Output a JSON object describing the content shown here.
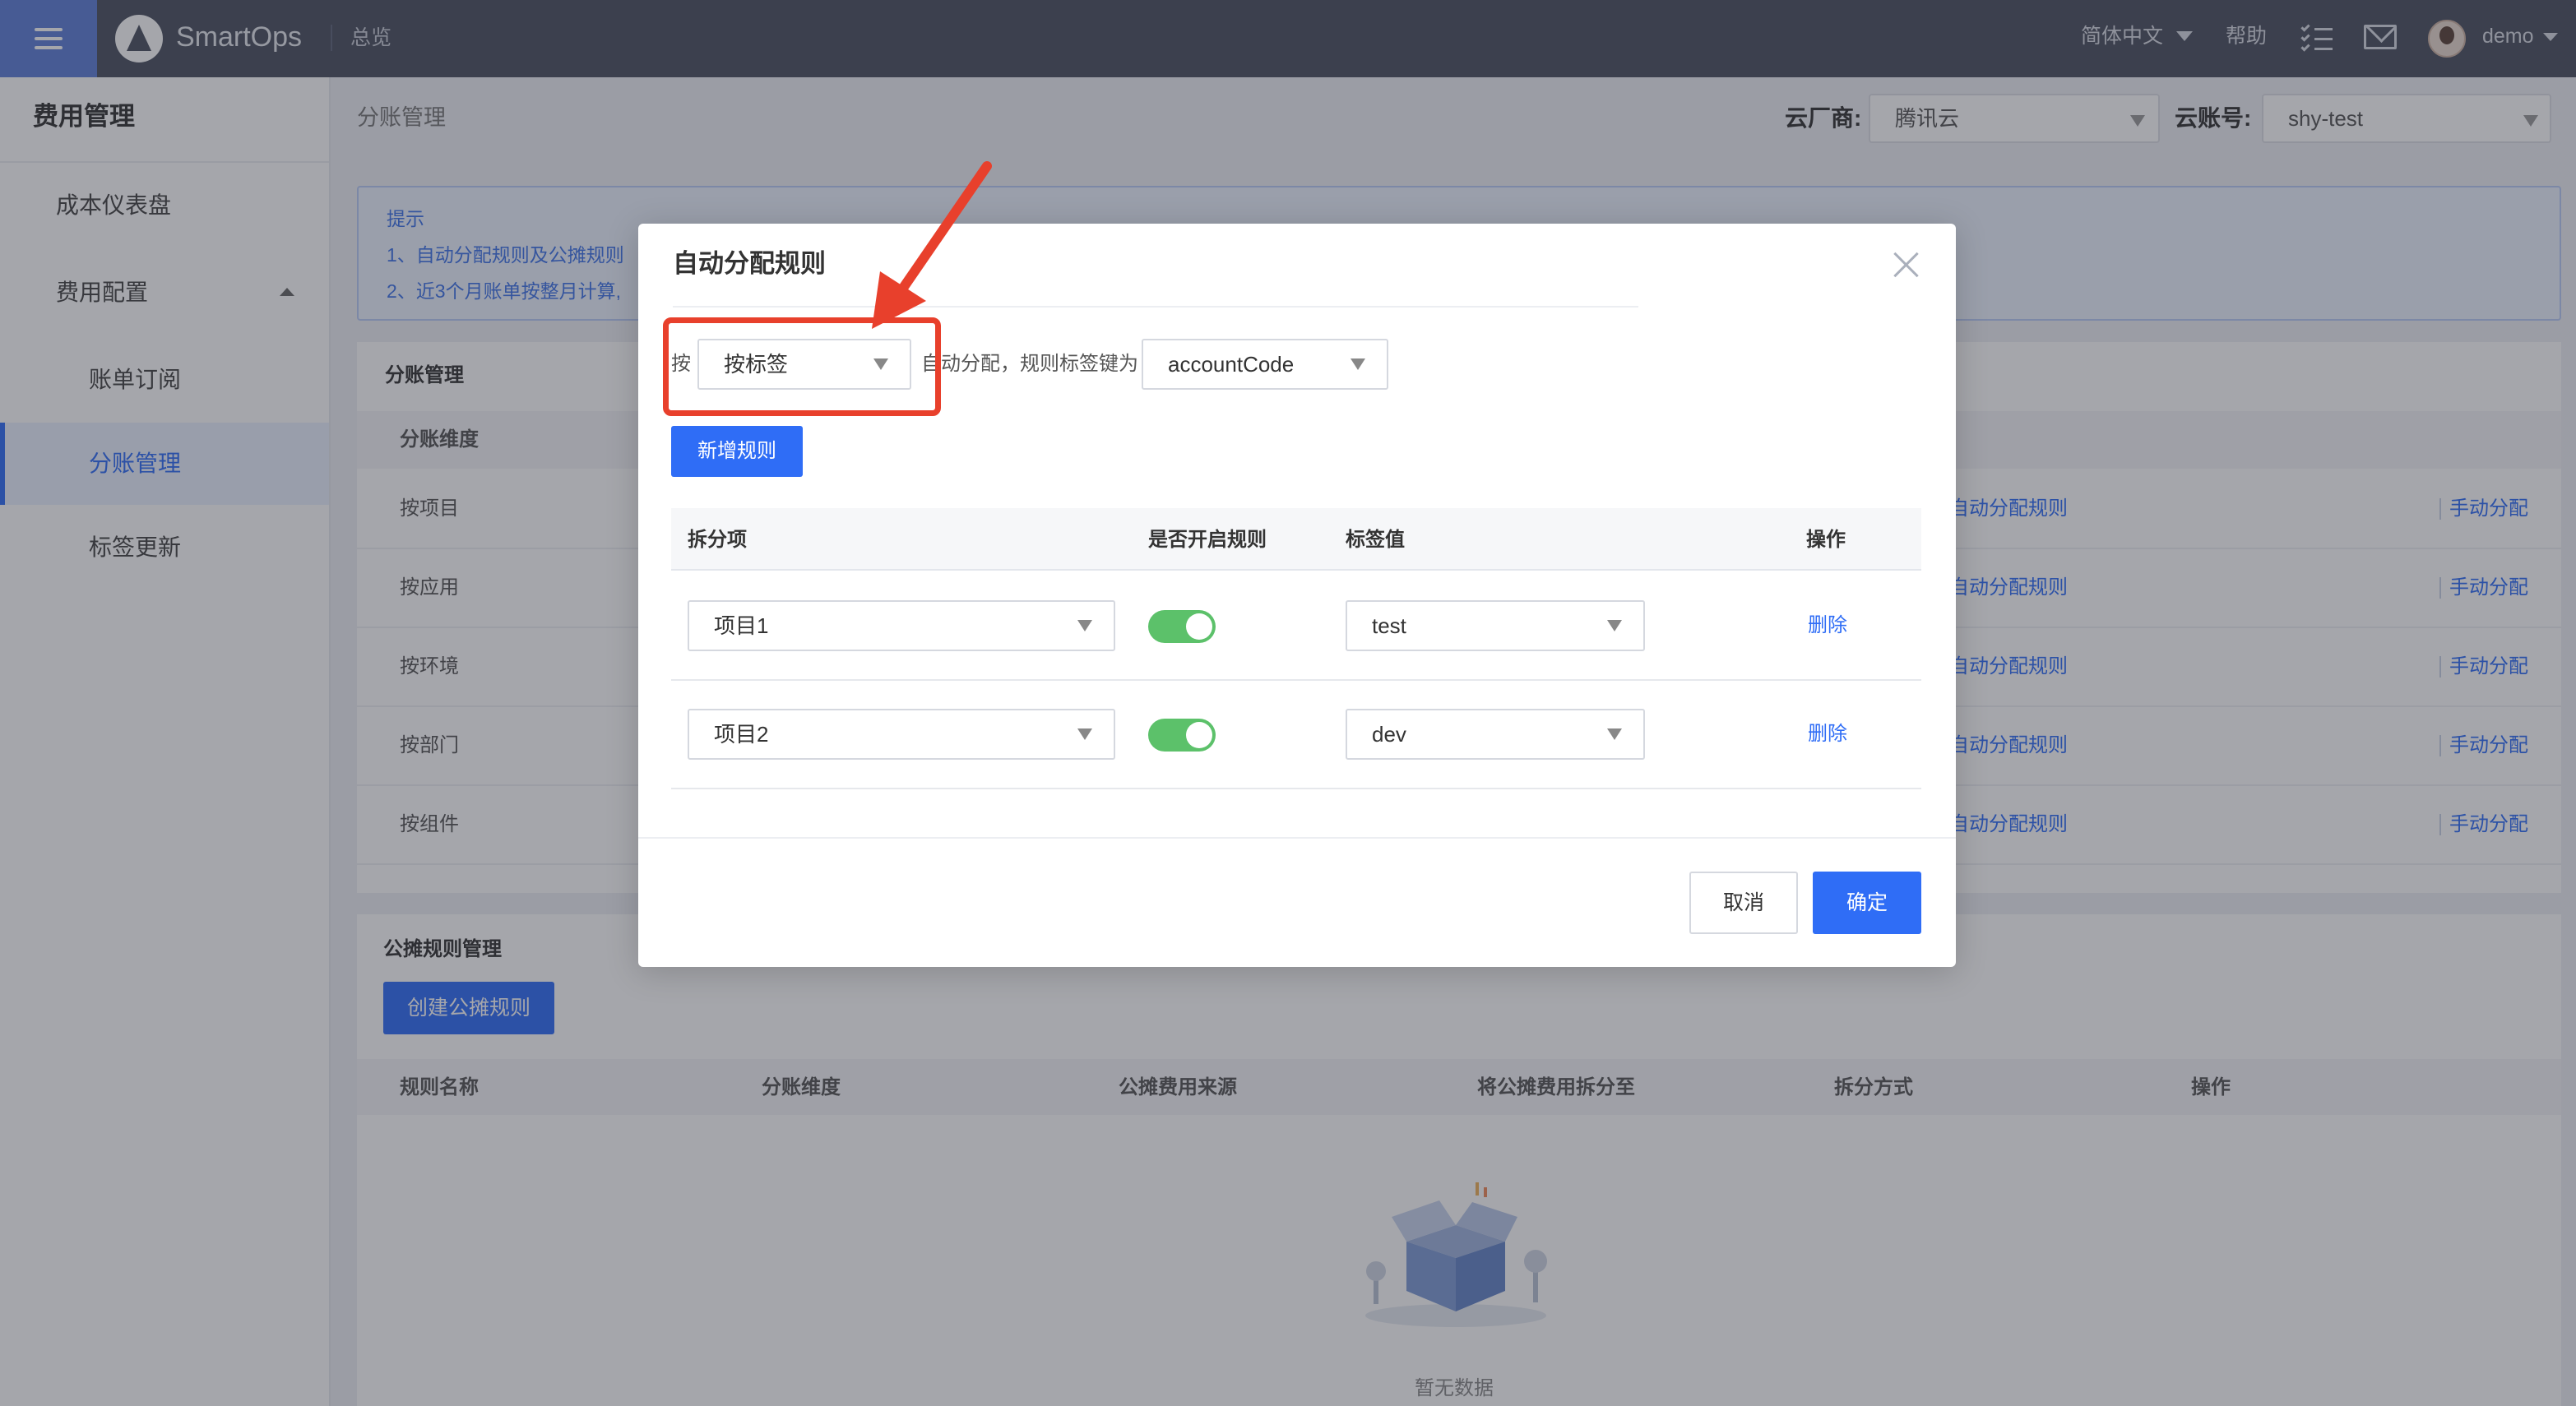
{
  "header": {
    "brand": "SmartOps",
    "nav_item": "总览",
    "language": "简体中文",
    "help": "帮助",
    "username": "demo",
    "icons": [
      "menu-icon",
      "smartops-logo-icon",
      "tasks-icon",
      "mail-icon",
      "avatar"
    ]
  },
  "sidebar": {
    "title": "费用管理",
    "items": [
      {
        "label": "成本仪表盘"
      },
      {
        "label": "费用配置"
      },
      {
        "label": "账单订阅"
      },
      {
        "label": "分账管理"
      },
      {
        "label": "标签更新"
      }
    ],
    "active": "分账管理"
  },
  "page": {
    "breadcrumb": "分账管理",
    "cloud_vendor_label": "云厂商:",
    "cloud_vendor_value": "腾讯云",
    "cloud_account_label": "云账号:",
    "cloud_account_value": "shy-test"
  },
  "tip": {
    "title": "提示",
    "line1": "1、自动分配规则及公摊规则",
    "line2": "2、近3个月账单按整月计算,"
  },
  "split_panel": {
    "title": "分账管理",
    "column": "分账维度",
    "rows": [
      {
        "label": "按项目",
        "action1": "自动分配规则",
        "action2": "手动分配"
      },
      {
        "label": "按应用",
        "action1": "自动分配规则",
        "action2": "手动分配"
      },
      {
        "label": "按环境",
        "action1": "自动分配规则",
        "action2": "手动分配"
      },
      {
        "label": "按部门",
        "action1": "自动分配规则",
        "action2": "手动分配"
      },
      {
        "label": "按组件",
        "action1": "自动分配规则",
        "action2": "手动分配"
      }
    ]
  },
  "share_panel": {
    "title": "公摊规则管理",
    "create_button": "创建公摊规则",
    "columns": [
      "规则名称",
      "分账维度",
      "公摊费用来源",
      "将公摊费用拆分至",
      "拆分方式",
      "操作"
    ],
    "empty_text": "暂无数据"
  },
  "modal": {
    "title": "自动分配规则",
    "prefix": "按",
    "mode_value": "按标签",
    "middle_text": "自动分配，规则标签键为",
    "tag_key_value": "accountCode",
    "add_rule_button": "新增规则",
    "columns": [
      "拆分项",
      "是否开启规则",
      "标签值",
      "操作"
    ],
    "rules": [
      {
        "item": "项目1",
        "enabled": true,
        "tag_value": "test",
        "action": "删除"
      },
      {
        "item": "项目2",
        "enabled": true,
        "tag_value": "dev",
        "action": "删除"
      }
    ],
    "cancel_button": "取消",
    "ok_button": "确定"
  },
  "colors": {
    "topbar": "#4a5060",
    "menu_button": "#5e7fd8",
    "primary": "#2f6df6",
    "toggle_on": "#5cc16a",
    "annotation": "#e8402c"
  }
}
